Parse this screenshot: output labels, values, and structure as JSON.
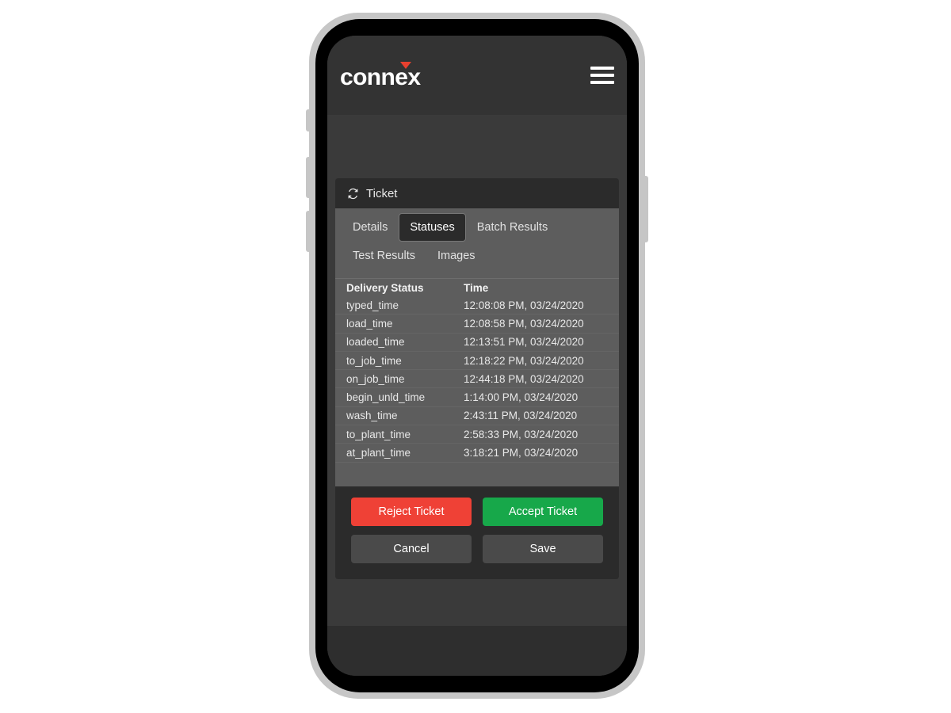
{
  "app": {
    "logo_text": "connex",
    "menu_icon": "hamburger-menu-icon"
  },
  "card": {
    "header_icon": "refresh-icon",
    "header_title": "Ticket"
  },
  "tabs": [
    {
      "label": "Details",
      "active": false
    },
    {
      "label": "Statuses",
      "active": true
    },
    {
      "label": "Batch Results",
      "active": false
    },
    {
      "label": "Test Results",
      "active": false
    },
    {
      "label": "Images",
      "active": false
    }
  ],
  "table": {
    "columns": [
      "Delivery Status",
      "Time"
    ],
    "rows": [
      {
        "status": "typed_time",
        "time": "12:08:08 PM, 03/24/2020"
      },
      {
        "status": "load_time",
        "time": "12:08:58 PM, 03/24/2020"
      },
      {
        "status": "loaded_time",
        "time": "12:13:51 PM, 03/24/2020"
      },
      {
        "status": "to_job_time",
        "time": "12:18:22 PM, 03/24/2020"
      },
      {
        "status": "on_job_time",
        "time": "12:44:18 PM, 03/24/2020"
      },
      {
        "status": "begin_unld_time",
        "time": "1:14:00 PM, 03/24/2020"
      },
      {
        "status": "wash_time",
        "time": "2:43:11 PM, 03/24/2020"
      },
      {
        "status": "to_plant_time",
        "time": "2:58:33 PM, 03/24/2020"
      },
      {
        "status": "at_plant_time",
        "time": "3:18:21 PM, 03/24/2020"
      }
    ]
  },
  "actions": {
    "reject_label": "Reject Ticket",
    "accept_label": "Accept Ticket",
    "cancel_label": "Cancel",
    "save_label": "Save"
  },
  "colors": {
    "reject": "#ef4136",
    "accept": "#17a84a",
    "neutral": "#4a4a4a",
    "logo_accent": "#e8402f",
    "card_body": "#5d5d5d",
    "card_header": "#2b2b2b",
    "screen_bg": "#3a3a3a"
  }
}
